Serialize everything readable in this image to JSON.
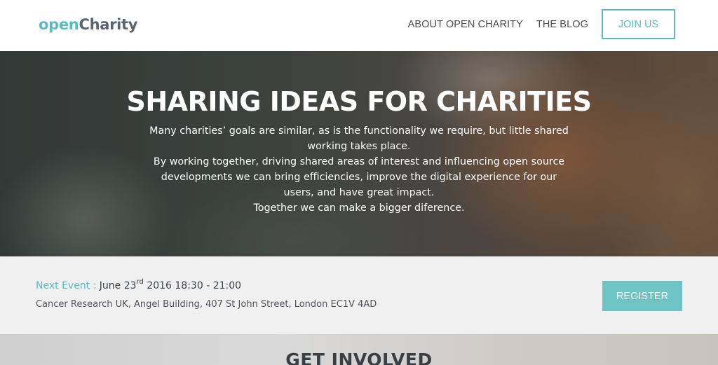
{
  "header": {
    "logo": {
      "part1": "open",
      "part2": "Charity"
    },
    "nav": [
      {
        "label": "ABOUT OPEN CHARITY"
      },
      {
        "label": "THE BLOG"
      }
    ],
    "join_label": "JOIN US"
  },
  "hero": {
    "title": "SHARING IDEAS FOR CHARITIES",
    "lines": [
      "Many charities’ goals are similar, as is the functionality we require, but little shared working takes place.",
      "By working together, driving shared areas of interest and influencing open source developments we can bring efficiencies, improve the digital experience for our users, and have great impact.",
      "Together we can make a bigger diference."
    ]
  },
  "event": {
    "label": "Next Event :",
    "date_prefix": "June 23",
    "date_suffix": "rd",
    "date_rest": "2016 18:30 - 21:00",
    "location": "Cancer Research UK, Angel Building, 407 St John Street, London EC1V 4AD",
    "register_label": "REGISTER"
  },
  "involved": {
    "title": "GET INVOLVED"
  },
  "colors": {
    "accent": "#5bbcc0",
    "register_bg": "#6ec3c5",
    "event_bg": "#f0f0f0"
  }
}
